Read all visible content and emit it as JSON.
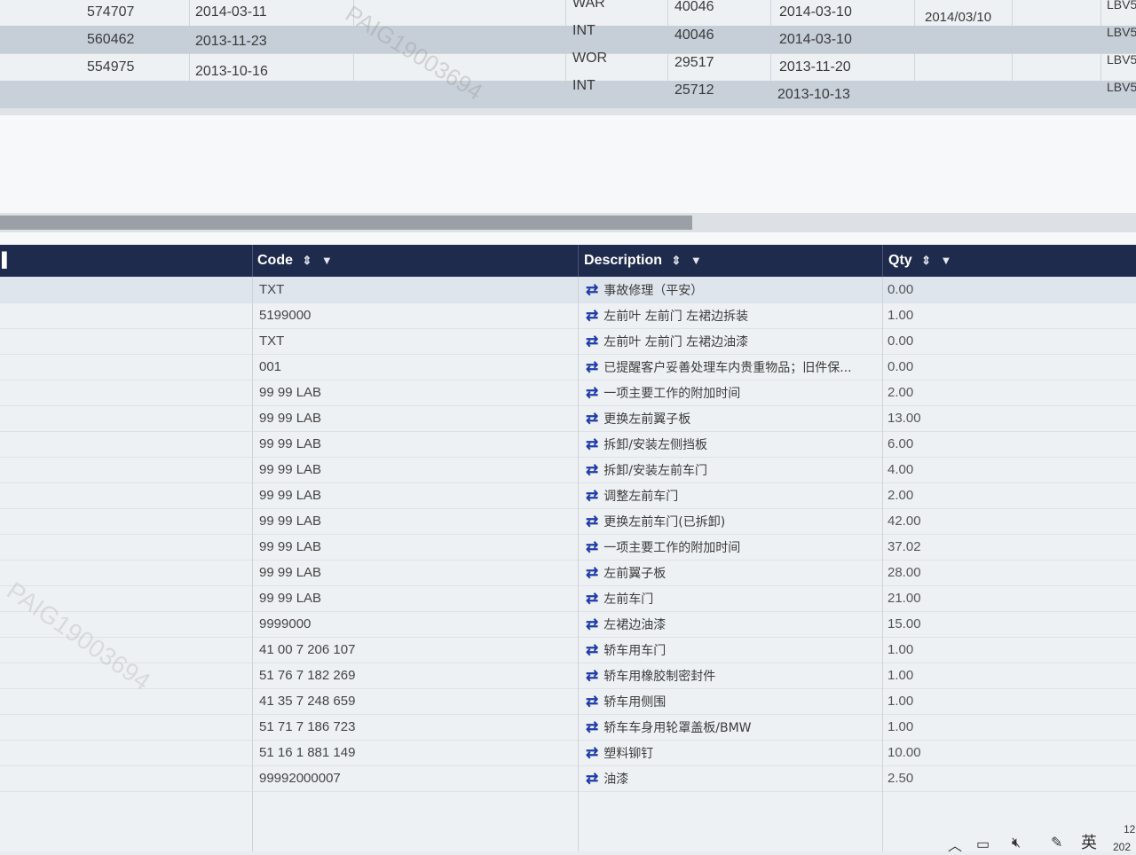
{
  "top_table": {
    "rows": [
      {
        "id": "574707",
        "date": "2014-03-11",
        "type": "WAR",
        "num": "40046",
        "date2": "2014-03-10",
        "extra": "2014/03/10",
        "vin": "LBV5"
      },
      {
        "id": "560462",
        "date": "2013-11-23",
        "type": "INT",
        "num": "40046",
        "date2": "2014-03-10",
        "extra": "",
        "vin": "LBV5"
      },
      {
        "id": "554975",
        "date": "2013-10-16",
        "type": "WOR",
        "num": "29517",
        "date2": "2013-11-20",
        "extra": "",
        "vin": "LBV5"
      },
      {
        "id": "",
        "date": "",
        "type": "INT",
        "num": "25712",
        "date2": "2013-10-13",
        "extra": "",
        "vin": "LBV5"
      }
    ],
    "watermark": "PAIG19003694"
  },
  "grid": {
    "headers": {
      "code": "Code",
      "description": "Description",
      "qty": "Qty"
    },
    "rows": [
      {
        "code": "TXT",
        "description": "事故修理（平安）",
        "qty": "0.00"
      },
      {
        "code": "5199000",
        "description": "左前叶 左前门 左裙边拆装",
        "qty": "1.00"
      },
      {
        "code": "TXT",
        "description": "左前叶 左前门 左裙边油漆",
        "qty": "0.00"
      },
      {
        "code": "001",
        "description": "已提醒客户妥善处理车内贵重物品；旧件保...",
        "qty": "0.00"
      },
      {
        "code": "99 99 LAB",
        "description": "一项主要工作的附加时间",
        "qty": "2.00"
      },
      {
        "code": "99 99 LAB",
        "description": "更换左前翼子板",
        "qty": "13.00"
      },
      {
        "code": "99 99 LAB",
        "description": "拆卸/安装左侧挡板",
        "qty": "6.00"
      },
      {
        "code": "99 99 LAB",
        "description": "拆卸/安装左前车门",
        "qty": "4.00"
      },
      {
        "code": "99 99 LAB",
        "description": "调整左前车门",
        "qty": "2.00"
      },
      {
        "code": "99 99 LAB",
        "description": "更换左前车门(已拆卸)",
        "qty": "42.00"
      },
      {
        "code": "99 99 LAB",
        "description": "一项主要工作的附加时间",
        "qty": "37.02"
      },
      {
        "code": "99 99 LAB",
        "description": "左前翼子板",
        "qty": "28.00"
      },
      {
        "code": "99 99 LAB",
        "description": "左前车门",
        "qty": "21.00"
      },
      {
        "code": "9999000",
        "description": "左裙边油漆",
        "qty": "15.00"
      },
      {
        "code": "41 00 7 206 107",
        "description": "轿车用车门",
        "qty": "1.00"
      },
      {
        "code": "51 76 7 182 269",
        "description": "轿车用橡胶制密封件",
        "qty": "1.00"
      },
      {
        "code": "41 35 7 248 659",
        "description": "轿车用侧围",
        "qty": "1.00"
      },
      {
        "code": "51 71 7 186 723",
        "description": "轿车车身用轮罩盖板/BMW",
        "qty": "1.00"
      },
      {
        "code": "51 16 1 881 149",
        "description": "塑料铆钉",
        "qty": "10.00"
      },
      {
        "code": "99992000007",
        "description": "油漆",
        "qty": "2.50"
      }
    ]
  },
  "taskbar": {
    "ime": "英",
    "clock_hint": "12",
    "year_hint": "202"
  },
  "icons": {
    "sort": "sort-icon",
    "filter": "filter-icon",
    "row_action": "swap-arrows-icon"
  },
  "colors": {
    "header_bg": "#1f2b4d",
    "action_icon": "#1e3ca8",
    "selected_row": "#c6ced8"
  }
}
